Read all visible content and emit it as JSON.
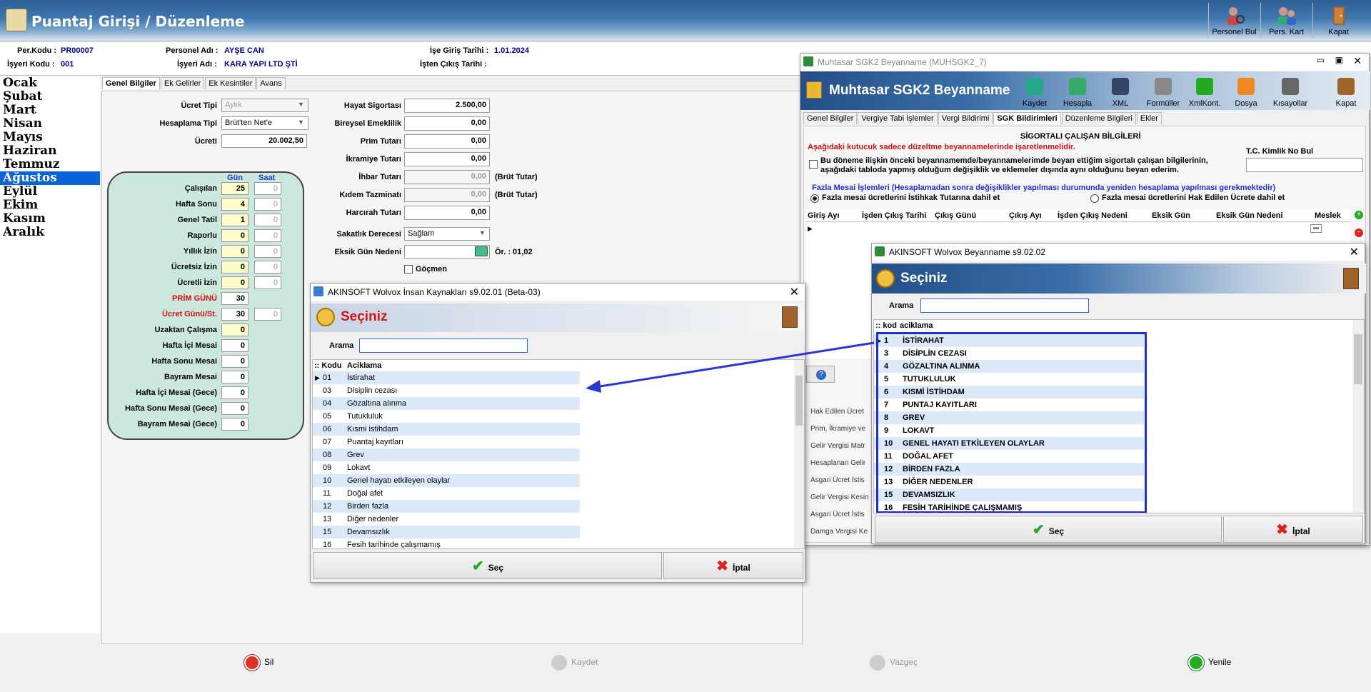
{
  "header": {
    "title": "Puantaj Girişi / Düzenleme",
    "buttons": [
      "Personel Bul",
      "Pers. Kart",
      "Kapat"
    ]
  },
  "info": {
    "per_kodu_lbl": "Per.Kodu :",
    "per_kodu": "PR00007",
    "personel_adi_lbl": "Personel Adı :",
    "personel_adi": "AYŞE CAN",
    "ise_giris_lbl": "İşe Giriş Tarihi :",
    "ise_giris": "1.01.2024",
    "isyeri_kodu_lbl": "İşyeri Kodu :",
    "isyeri_kodu": "001",
    "isyeri_adi_lbl": "İşyeri Adı :",
    "isyeri_adi": "KARA YAPI LTD ŞTİ",
    "isten_cikis_lbl": "İşten Çıkış Tarihi :"
  },
  "months": [
    "Ocak",
    "Şubat",
    "Mart",
    "Nisan",
    "Mayıs",
    "Haziran",
    "Temmuz",
    "Ağustos",
    "Eylül",
    "Ekim",
    "Kasım",
    "Aralık"
  ],
  "main_tabs": [
    "Genel Bilgiler",
    "Ek Gelirler",
    "Ek Kesintiler",
    "Avans"
  ],
  "form": {
    "ucret_tipi_lbl": "Ücret Tipi",
    "ucret_tipi": "Aylık",
    "hesaplama_tipi_lbl": "Hesaplama Tipi",
    "hesaplama_tipi": "Brüt'ten Net'e",
    "ucreti_lbl": "Ücreti",
    "ucreti": "20.002,50",
    "gun_lbl": "Gün",
    "saat_lbl": "Saat",
    "rows": [
      {
        "label": "Çalışılan",
        "gun": "25",
        "saat": "0"
      },
      {
        "label": "Hafta Sonu",
        "gun": "4",
        "saat": "0"
      },
      {
        "label": "Genel Tatil",
        "gun": "1",
        "saat": "0"
      },
      {
        "label": "Raporlu",
        "gun": "0",
        "saat": "0"
      },
      {
        "label": "Yıllık İzin",
        "gun": "0",
        "saat": "0"
      },
      {
        "label": "Ücretsiz İzin",
        "gun": "0",
        "saat": "0"
      },
      {
        "label": "Ücretli İzin",
        "gun": "0",
        "saat": "0"
      },
      {
        "label": "PRİM GÜNÜ",
        "gun": "30",
        "saat": ""
      },
      {
        "label": "Ücret Günü/St.",
        "gun": "30",
        "saat": "0"
      },
      {
        "label": "Uzaktan Çalışma",
        "gun": "0",
        "saat": ""
      },
      {
        "label": "Hafta İçi Mesai",
        "gun": "0",
        "saat": ""
      },
      {
        "label": "Hafta Sonu Mesai",
        "gun": "0",
        "saat": ""
      },
      {
        "label": "Bayram Mesai",
        "gun": "0",
        "saat": ""
      },
      {
        "label": "Hafta İçi Mesai (Gece)",
        "gun": "0",
        "saat": ""
      },
      {
        "label": "Hafta Sonu Mesai (Gece)",
        "gun": "0",
        "saat": ""
      },
      {
        "label": "Bayram Mesai (Gece)",
        "gun": "0",
        "saat": ""
      }
    ],
    "right": [
      {
        "label": "Hayat Sigortası",
        "value": "2.500,00",
        "note": ""
      },
      {
        "label": "Bireysel Emeklilik",
        "value": "0,00",
        "note": ""
      },
      {
        "label": "Prim Tutarı",
        "value": "0,00",
        "note": ""
      },
      {
        "label": "İkramiye Tutarı",
        "value": "0,00",
        "note": ""
      },
      {
        "label": "İhbar Tutarı",
        "value": "0,00",
        "note": "(Brüt Tutar)"
      },
      {
        "label": "Kıdem Tazminatı",
        "value": "0,00",
        "note": "(Brüt Tutar)"
      },
      {
        "label": "Harcırah Tutarı",
        "value": "0,00",
        "note": ""
      }
    ],
    "sakatlik_lbl": "Sakatlık Derecesi",
    "sakatlik": "Sağlam",
    "eksik_gun_lbl": "Eksik Gün Nedeni",
    "eksik_gun_hint": "Ör. : 01,02",
    "gocmen_lbl": "Göçmen"
  },
  "bottom": {
    "sil": "Sil",
    "kaydet": "Kaydet",
    "vazgec": "Vazgeç",
    "yenile": "Yenile"
  },
  "dlg1": {
    "title": "AKINSOFT Wolvox İnsan Kaynakları s9.02.01 (Beta-03)",
    "heading": "Seçiniz",
    "arama": "Arama",
    "col_kod": "Kodu",
    "col_acik": "Aciklama",
    "rows": [
      [
        "01",
        "İstirahat"
      ],
      [
        "03",
        "Disiplin cezası"
      ],
      [
        "04",
        "Gözaltına alınma"
      ],
      [
        "05",
        "Tutukluluk"
      ],
      [
        "06",
        "Kısmi istihdam"
      ],
      [
        "07",
        "Puantaj kayıtları"
      ],
      [
        "08",
        "Grev"
      ],
      [
        "09",
        "Lokavt"
      ],
      [
        "10",
        "Genel hayatı etkileyen olaylar"
      ],
      [
        "11",
        "Doğal afet"
      ],
      [
        "12",
        "Birden fazla"
      ],
      [
        "13",
        "Diğer nedenler"
      ],
      [
        "15",
        "Devamsızlık"
      ],
      [
        "16",
        "Fesih tarihinde çalışmamış"
      ]
    ],
    "sec": "Seç",
    "iptal": "İptal"
  },
  "sgk": {
    "title": "Muhtasar SGK2  Beyanname (MUHSGK2_7)",
    "heading": "Muhtasar SGK2  Beyanname",
    "toolbar": [
      "Kaydet",
      "Hesapla",
      "XML",
      "Formüller",
      "XmlKont.",
      "Dosya",
      "Kısayollar",
      "Kapat"
    ],
    "tabs": [
      "Genel Bilgiler",
      "Vergiye Tabi İşlemler",
      "Vergi Bildirimi",
      "SGK Bildirimleri",
      "Düzenleme Bilgileri",
      "Ekler"
    ],
    "section": "SİGORTALI ÇALIŞAN BİLGİLERİ",
    "warning": "Aşağıdaki kutucuk sadece düzeltme beyannamelerinde işaretlenmelidir.",
    "check_text": "Bu döneme ilişkin önceki beyannamemde/beyannamelerimde beyan ettiğim sigortalı çalışan bilgilerinin, aşağıdaki tabloda yapmış olduğum değişiklik ve eklemeler dışında aynı olduğunu beyan ederim.",
    "tc_lbl": "T.C. Kimlik No Bul",
    "fazla_mesai": "Fazla Mesai İşlemleri (Hesaplamadan sonra değişiklikler yapılması durumunda yeniden hesaplama yapılması gerekmektedir)",
    "radio1": "Fazla mesai ücretlerini İstihkak Tutarına dahil et",
    "radio2": "Fazla mesai ücretlerini Hak Edilen Ücrete dahil et",
    "cols": [
      "Giriş Ayı",
      "İşden Çıkış Tarihi",
      "Çıkış Günü",
      "Çıkış Ayı",
      "İşden Çıkış Nedeni",
      "Eksik Gün",
      "Eksik Gün Nedeni",
      "Meslek"
    ],
    "side_labels": [
      "Hak Edilen Ücret",
      "Prim, İkramiye ve",
      "Gelir Vergisi Matr",
      "Hesaplanan Gelir",
      "Asgari Ücret İstis",
      "Gelir Vergisi Kesin",
      "Asgari Ücret İstis",
      "Damga Vergisi Ke"
    ]
  },
  "dlg2": {
    "title": "AKINSOFT Wolvox Beyanname s9.02.02",
    "heading": "Seçiniz",
    "arama": "Arama",
    "col_kod": "kod",
    "col_acik": "aciklama",
    "rows": [
      [
        "1",
        "İSTİRAHAT"
      ],
      [
        "3",
        "DİSİPLİN CEZASI"
      ],
      [
        "4",
        "GÖZALTINA ALINMA"
      ],
      [
        "5",
        "TUTUKLULUK"
      ],
      [
        "6",
        "KISMİ İSTİHDAM"
      ],
      [
        "7",
        "PUNTAJ KAYITLARI"
      ],
      [
        "8",
        "GREV"
      ],
      [
        "9",
        "LOKAVT"
      ],
      [
        "10",
        "GENEL HAYATI ETKİLEYEN OLAYLAR"
      ],
      [
        "11",
        "DOĞAL AFET"
      ],
      [
        "12",
        "BİRDEN FAZLA"
      ],
      [
        "13",
        "DİĞER NEDENLER"
      ],
      [
        "15",
        "DEVAMSIZLIK"
      ],
      [
        "16",
        "FESİH TARİHİNDE ÇALIŞMAMIŞ"
      ]
    ],
    "sec": "Seç",
    "iptal": "İptal"
  }
}
